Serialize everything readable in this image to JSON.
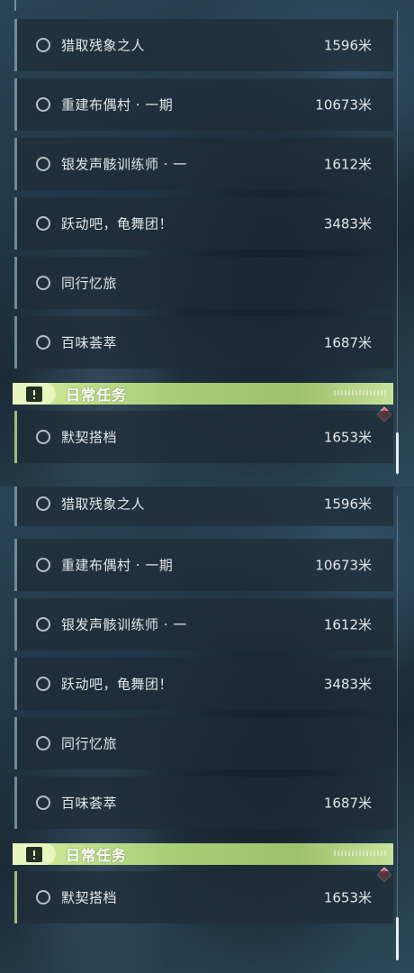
{
  "quests": [
    {
      "name": "猎取残象之人",
      "distance": "1596米"
    },
    {
      "name": "重建布偶村 · 一期",
      "distance": "10673米"
    },
    {
      "name": "银发声骸训练师 · 一",
      "distance": "1612米"
    },
    {
      "name": "跃动吧，龟舞团！",
      "distance": "3483米"
    },
    {
      "name": "同行忆旅",
      "distance": ""
    },
    {
      "name": "百味荟萃",
      "distance": "1687米"
    }
  ],
  "daily_section": {
    "title": "日常任务",
    "icon": "daily-quest-icon"
  },
  "daily_quests": [
    {
      "name": "默契搭档",
      "distance": "1653米"
    }
  ],
  "colors": {
    "section_accent": "#a9cf78",
    "tracked_marker": "#e0505c",
    "quest_bar": "#6c8d9c"
  }
}
